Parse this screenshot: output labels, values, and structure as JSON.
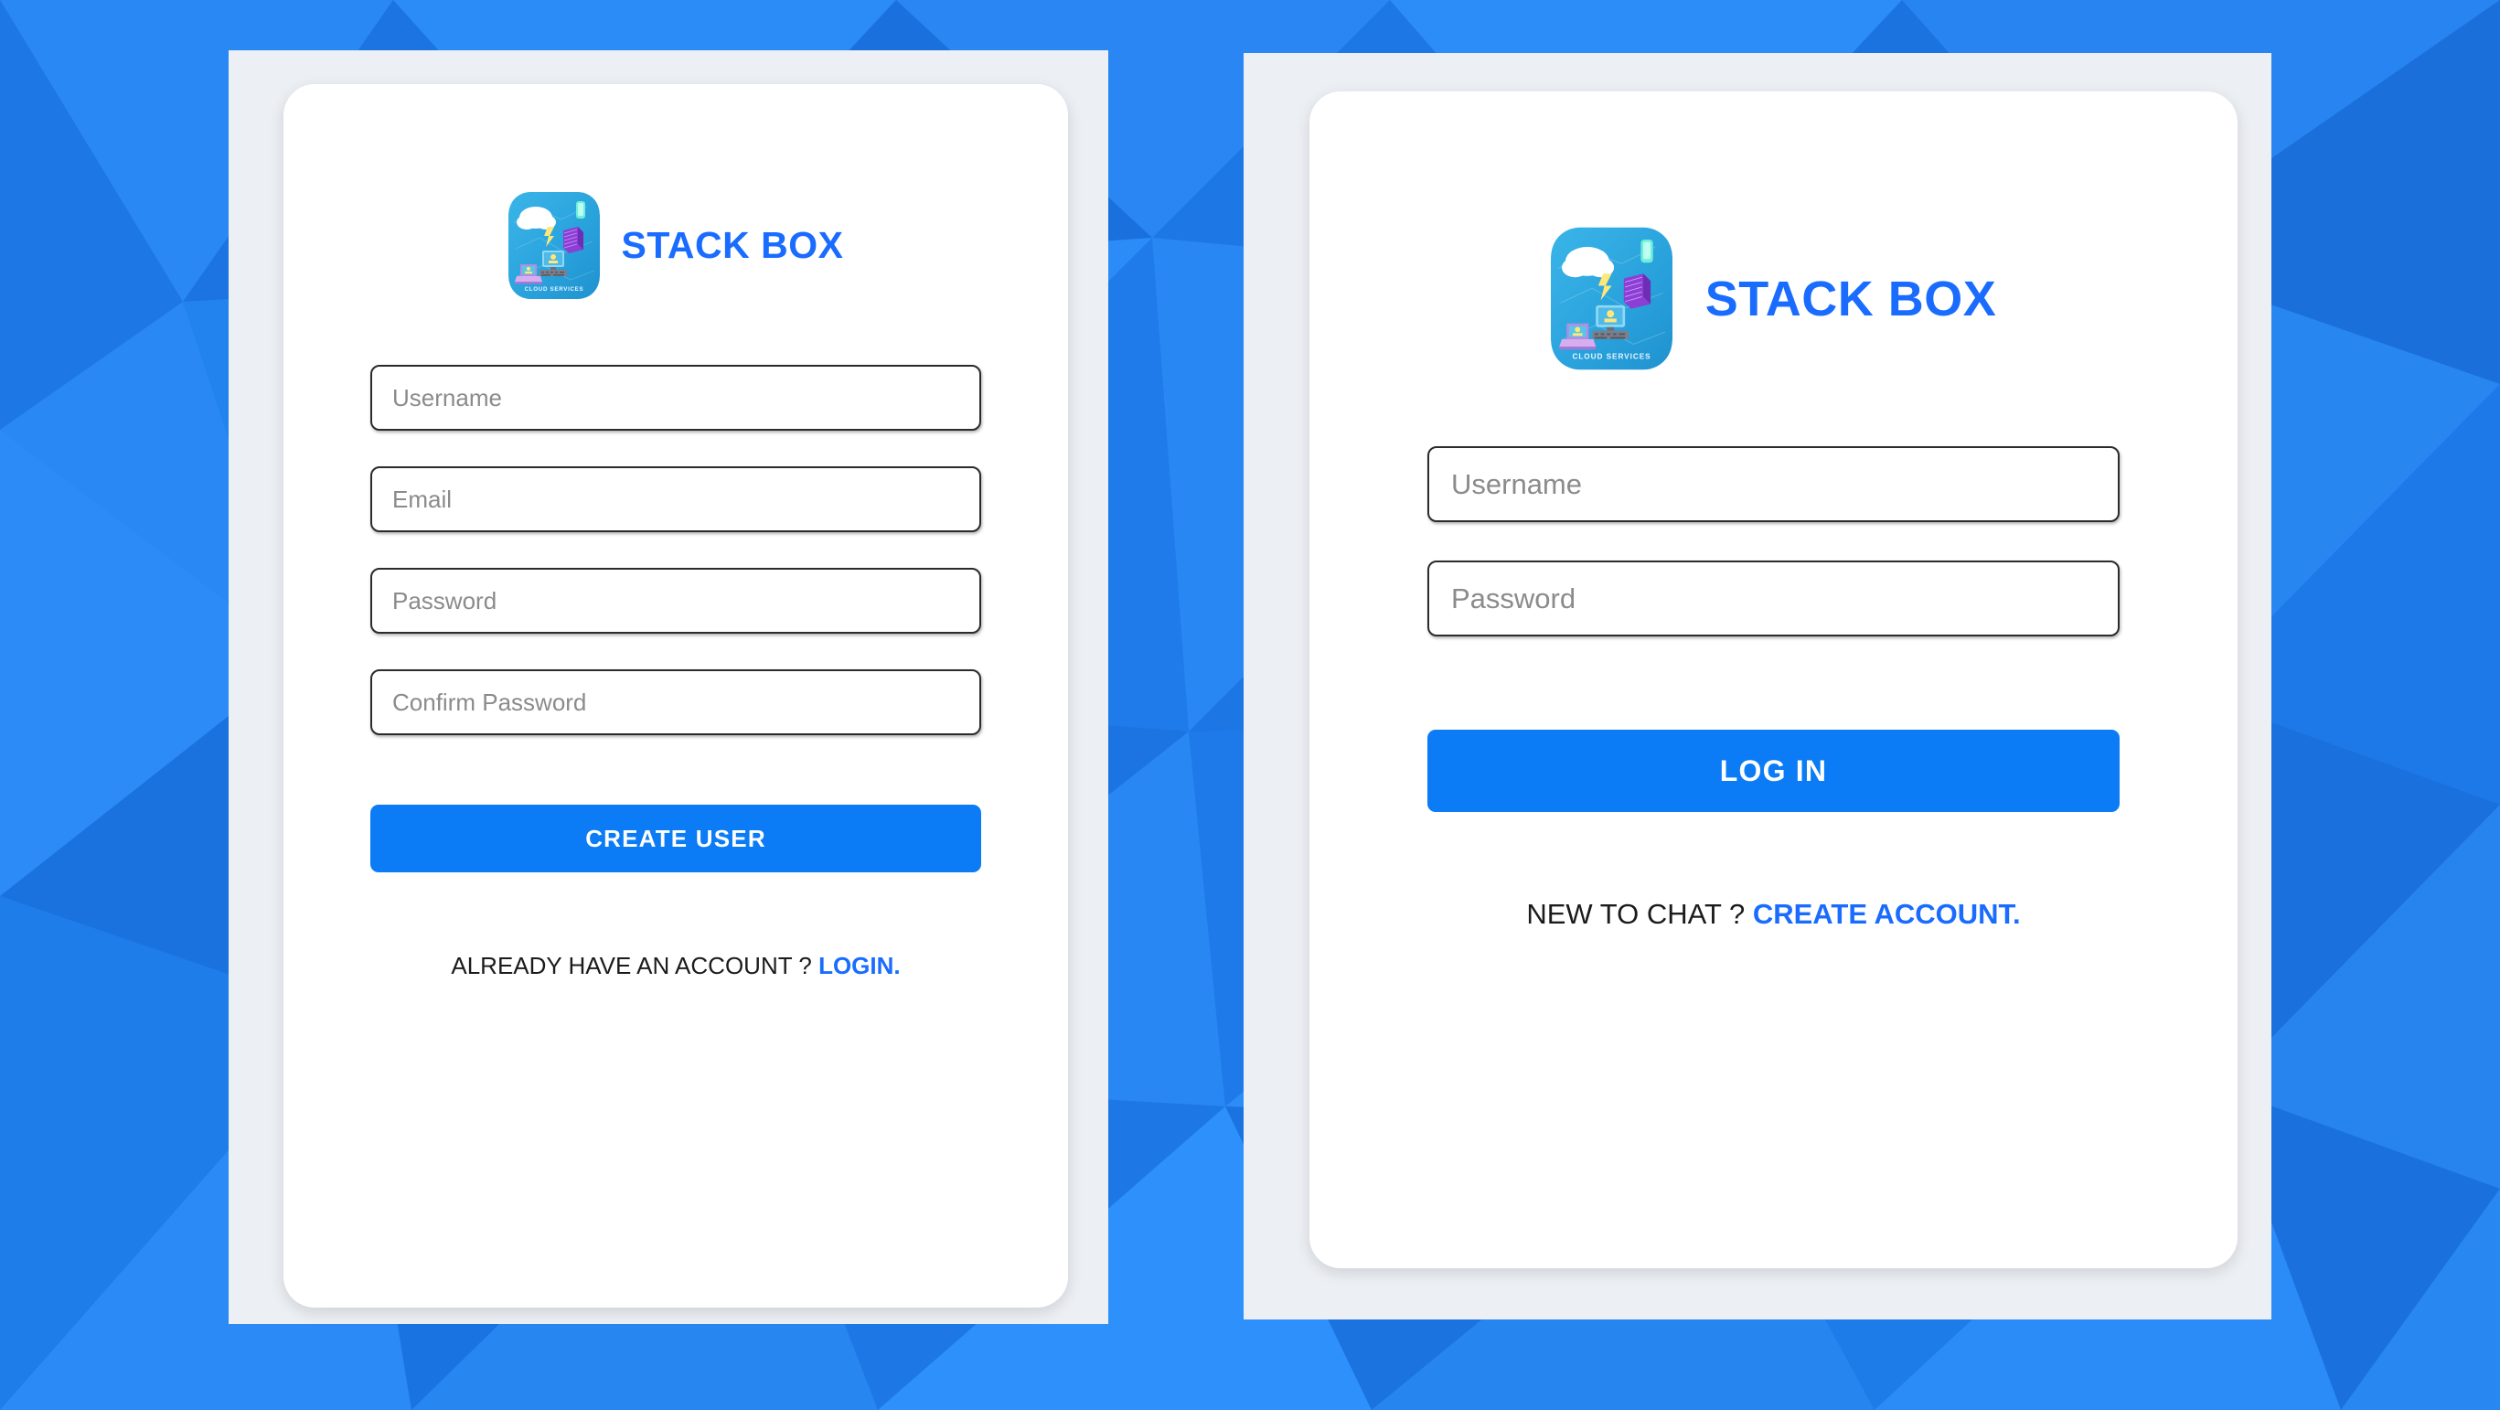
{
  "theme": {
    "background_blue": "#1e7ceb",
    "panel_gray": "#eceff4",
    "card_white": "#ffffff",
    "accent_blue": "#1a6cff",
    "button_blue": "#0b7cf5",
    "field_border": "#2b2b2b",
    "placeholder_gray": "#8b8b8b"
  },
  "brand": {
    "name": "STACK BOX",
    "logo_icon": "cloud-services-logo",
    "logo_caption": "CLOUD SERVICES"
  },
  "signup_card": {
    "fields": [
      {
        "name": "username",
        "placeholder": "Username",
        "value": "",
        "type": "text"
      },
      {
        "name": "email",
        "placeholder": "Email",
        "value": "",
        "type": "text"
      },
      {
        "name": "password",
        "placeholder": "Password",
        "value": "",
        "type": "password"
      },
      {
        "name": "confirm_password",
        "placeholder": "Confirm Password",
        "value": "",
        "type": "password"
      }
    ],
    "submit_label": "CREATE USER",
    "switch_prompt": "ALREADY HAVE AN ACCOUNT ? ",
    "switch_link": "LOGIN."
  },
  "login_card": {
    "fields": [
      {
        "name": "username",
        "placeholder": "Username",
        "value": "",
        "type": "text"
      },
      {
        "name": "password",
        "placeholder": "Password",
        "value": "",
        "type": "password"
      }
    ],
    "submit_label": "LOG IN",
    "switch_prompt": "NEW TO CHAT ? ",
    "switch_link": "CREATE ACCOUNT."
  }
}
